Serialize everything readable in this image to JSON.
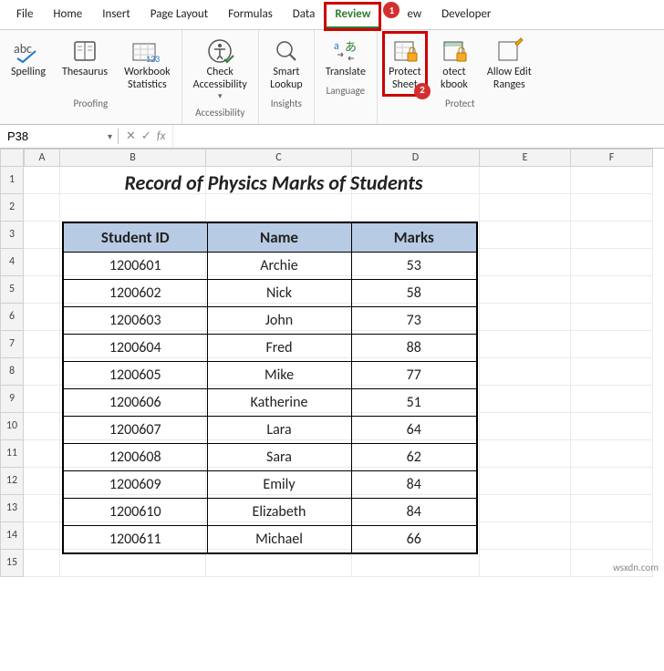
{
  "tabs": {
    "file": "File",
    "home": "Home",
    "insert": "Insert",
    "page_layout": "Page Layout",
    "formulas": "Formulas",
    "data": "Data",
    "review": "Review",
    "view": "ew",
    "developer": "Developer"
  },
  "ribbon": {
    "proofing": {
      "title": "Proofing",
      "spelling": "Spelling",
      "thesaurus": "Thesaurus",
      "stats": "Workbook\nStatistics"
    },
    "accessibility": {
      "title": "Accessibility",
      "check": "Check\nAccessibility"
    },
    "insights": {
      "title": "Insights",
      "smart": "Smart\nLookup"
    },
    "language": {
      "title": "Language",
      "translate": "Translate"
    },
    "protect": {
      "title": "Protect",
      "sheet": "Protect\nSheet",
      "workbook": "otect\nkbook",
      "ranges": "Allow Edit\nRanges"
    }
  },
  "badges": {
    "one": "1",
    "two": "2"
  },
  "namebox": "P38",
  "fx": "fx",
  "columns": [
    "A",
    "B",
    "C",
    "D",
    "E",
    "F"
  ],
  "row_count": 15,
  "title": "Record of Physics Marks of Students",
  "table": {
    "headers": [
      "Student ID",
      "Name",
      "Marks"
    ],
    "rows": [
      [
        "1200601",
        "Archie",
        "53"
      ],
      [
        "1200602",
        "Nick",
        "58"
      ],
      [
        "1200603",
        "John",
        "73"
      ],
      [
        "1200604",
        "Fred",
        "88"
      ],
      [
        "1200605",
        "Mike",
        "77"
      ],
      [
        "1200606",
        "Katherine",
        "51"
      ],
      [
        "1200607",
        "Lara",
        "64"
      ],
      [
        "1200608",
        "Sara",
        "62"
      ],
      [
        "1200609",
        "Emily",
        "84"
      ],
      [
        "1200610",
        "Elizabeth",
        "84"
      ],
      [
        "1200611",
        "Michael",
        "66"
      ]
    ]
  },
  "watermark": "wsxdn.com"
}
